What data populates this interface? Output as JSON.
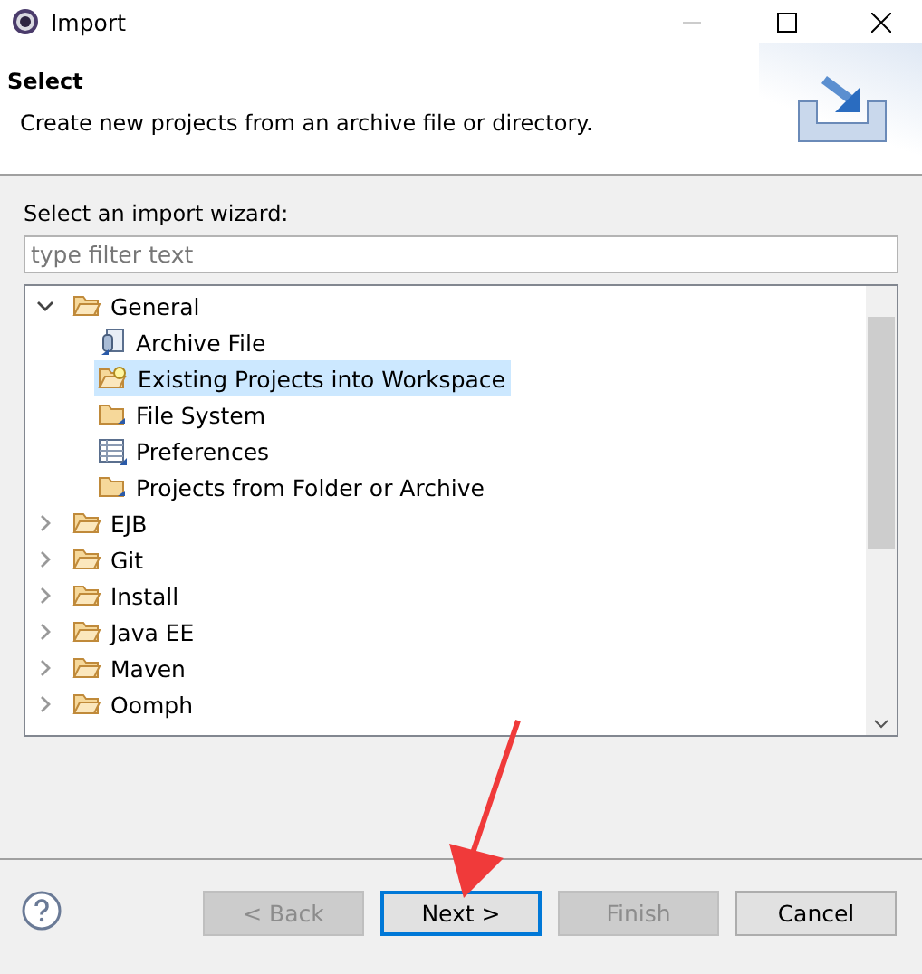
{
  "window": {
    "title": "Import"
  },
  "header": {
    "title": "Select",
    "description": "Create new projects from an archive file or directory."
  },
  "wizard_label": "Select an import wizard:",
  "filter": {
    "placeholder": "type filter text"
  },
  "tree": [
    {
      "label": "General",
      "kind": "folder",
      "expanded": true,
      "selected": false,
      "children": [
        {
          "label": "Archive File",
          "kind": "archive",
          "selected": false
        },
        {
          "label": "Existing Projects into Workspace",
          "kind": "project",
          "selected": true
        },
        {
          "label": "File System",
          "kind": "folder",
          "selected": false
        },
        {
          "label": "Preferences",
          "kind": "preferences",
          "selected": false
        },
        {
          "label": "Projects from Folder or Archive",
          "kind": "folder",
          "selected": false
        }
      ]
    },
    {
      "label": "EJB",
      "kind": "folder",
      "expanded": false,
      "selected": false
    },
    {
      "label": "Git",
      "kind": "folder",
      "expanded": false,
      "selected": false
    },
    {
      "label": "Install",
      "kind": "folder",
      "expanded": false,
      "selected": false
    },
    {
      "label": "Java EE",
      "kind": "folder",
      "expanded": false,
      "selected": false
    },
    {
      "label": "Maven",
      "kind": "folder",
      "expanded": false,
      "selected": false
    },
    {
      "label": "Oomph",
      "kind": "folder",
      "expanded": false,
      "selected": false
    }
  ],
  "buttons": [
    {
      "label": "< Back",
      "disabled": true,
      "focused": false
    },
    {
      "label": "Next >",
      "disabled": false,
      "focused": true
    },
    {
      "label": "Finish",
      "disabled": true,
      "focused": false
    },
    {
      "label": "Cancel",
      "disabled": false,
      "focused": false
    }
  ]
}
